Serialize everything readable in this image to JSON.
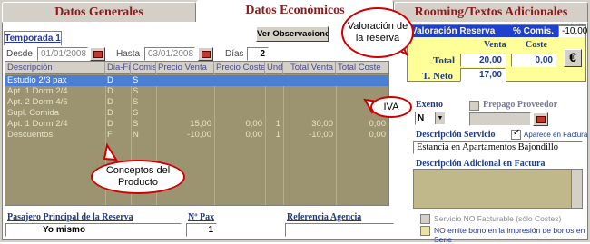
{
  "tabs": [
    {
      "label": "Datos Generales"
    },
    {
      "label": "Datos Económicos"
    },
    {
      "label": "Rooming/Textos Adicionales Reserva"
    }
  ],
  "subtab": {
    "label": "Temporada 1"
  },
  "dates": {
    "desde_label": "Desde",
    "desde_value": "01/01/2008",
    "hasta_label": "Hasta",
    "hasta_value": "03/01/2008",
    "dias_label": "Días",
    "dias_value": "2"
  },
  "observaciones_button": "Ver Observaciones",
  "grid": {
    "columns": [
      "Descripción",
      "Dia-Fij",
      "Comis",
      "Precio Venta",
      "Precio Coste",
      "Und",
      "Total Venta",
      "Total Coste"
    ],
    "rows": [
      {
        "desc": "Estudio 2/3 pax",
        "diafij": "D",
        "comis": "S",
        "pventa": "",
        "pcoste": "",
        "und": "",
        "tventa": "",
        "tcoste": ""
      },
      {
        "desc": "Apt. 1 Dorm 2/4",
        "diafij": "D",
        "comis": "S",
        "pventa": "",
        "pcoste": "",
        "und": "",
        "tventa": "",
        "tcoste": ""
      },
      {
        "desc": "Apt. 2 Dorm 4/6",
        "diafij": "D",
        "comis": "S",
        "pventa": "",
        "pcoste": "",
        "und": "",
        "tventa": "",
        "tcoste": ""
      },
      {
        "desc": "Supl. Comida",
        "diafij": "D",
        "comis": "S",
        "pventa": "",
        "pcoste": "",
        "und": "",
        "tventa": "",
        "tcoste": ""
      },
      {
        "desc": "Apt. 1 Dorm 2/4",
        "diafij": "D",
        "comis": "S",
        "pventa": "15,00",
        "pcoste": "0,00",
        "und": "1",
        "tventa": "30,00",
        "tcoste": "0,00"
      },
      {
        "desc": "Descuentos",
        "diafij": "F",
        "comis": "N",
        "pventa": "-10,00",
        "pcoste": "0,00",
        "und": "1",
        "tventa": "-10,00",
        "tcoste": "0,00"
      }
    ]
  },
  "valoracion": {
    "header": "Valoración Reserva",
    "comis_label": "% Comis.",
    "comis_value": "-10,00",
    "venta_label": "Venta",
    "coste_label": "Coste",
    "total_label": "Total",
    "total_venta": "20,00",
    "total_coste": "0,00",
    "tneto_label": "T. Neto",
    "tneto_venta": "17,00",
    "euro_button": "€"
  },
  "exento": {
    "label": "Exento",
    "value": "N"
  },
  "prepago": {
    "label": "Prepago Proveedor"
  },
  "descripcion_servicio": {
    "label": "Descripción Servicio",
    "aparece_label": "Aparece en Factura",
    "value": "Estancia en Apartamentos Bajondillo"
  },
  "descripcion_adicional": {
    "label": "Descripción Adicional en Factura"
  },
  "servicio_no_facturable": "Servicio NO Facturable (sólo Costes)",
  "no_emite_bono": "NO emite bono en la impresión de bonos en Serie",
  "footer": {
    "pasajero_label": "Pasajero Principal de la Reserva",
    "pasajero_value": "Yo mismo",
    "npax_label": "Nº Pax",
    "npax_value": "1",
    "referencia_label": "Referencia Agencia",
    "referencia_value": ""
  },
  "callouts": {
    "valoracion": "Valoración de la reserva",
    "iva": "IVA",
    "conceptos": "Conceptos del Producto"
  }
}
